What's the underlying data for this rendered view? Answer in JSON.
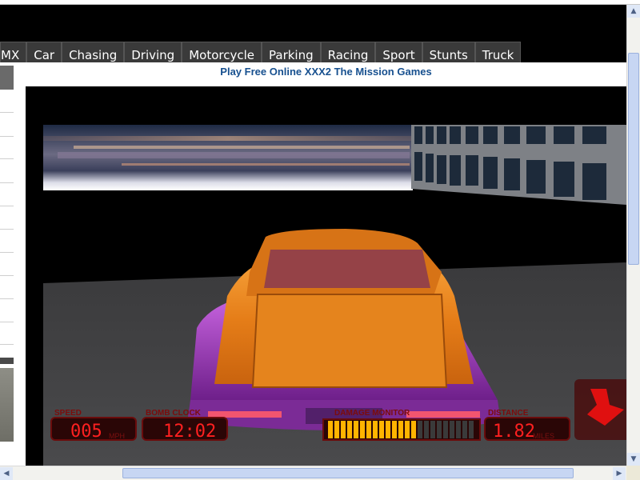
{
  "nav": {
    "tabs": [
      {
        "label": "MX"
      },
      {
        "label": "Car"
      },
      {
        "label": "Chasing"
      },
      {
        "label": "Driving"
      },
      {
        "label": "Motorcycle"
      },
      {
        "label": "Parking"
      },
      {
        "label": "Racing"
      },
      {
        "label": "Sport"
      },
      {
        "label": "Stunts"
      },
      {
        "label": "Truck"
      }
    ]
  },
  "page": {
    "title": "Play Free Online XXX2 The Mission Games"
  },
  "game": {
    "hud": {
      "speed": {
        "label": "SPEED",
        "value": "005",
        "unit": "MPH"
      },
      "bomb_clock": {
        "label": "BOMB CLOCK",
        "value": "12:02"
      },
      "damage_monitor": {
        "label": "DAMAGE MONITOR"
      },
      "distance": {
        "label": "DISTANCE",
        "value": "1.82",
        "unit": "MILES"
      }
    },
    "colors": {
      "car_body": "#e8821c",
      "car_underside": "#a83fc2",
      "hud_red": "#ff2020"
    },
    "icons": {
      "direction": "direction-arrow-icon"
    }
  },
  "scrollbars": {
    "vertical": {
      "up": "scroll-up-arrow-icon",
      "down": "scroll-down-arrow-icon"
    },
    "horizontal": {
      "left": "scroll-left-arrow-icon",
      "right": "scroll-right-arrow-icon"
    }
  }
}
